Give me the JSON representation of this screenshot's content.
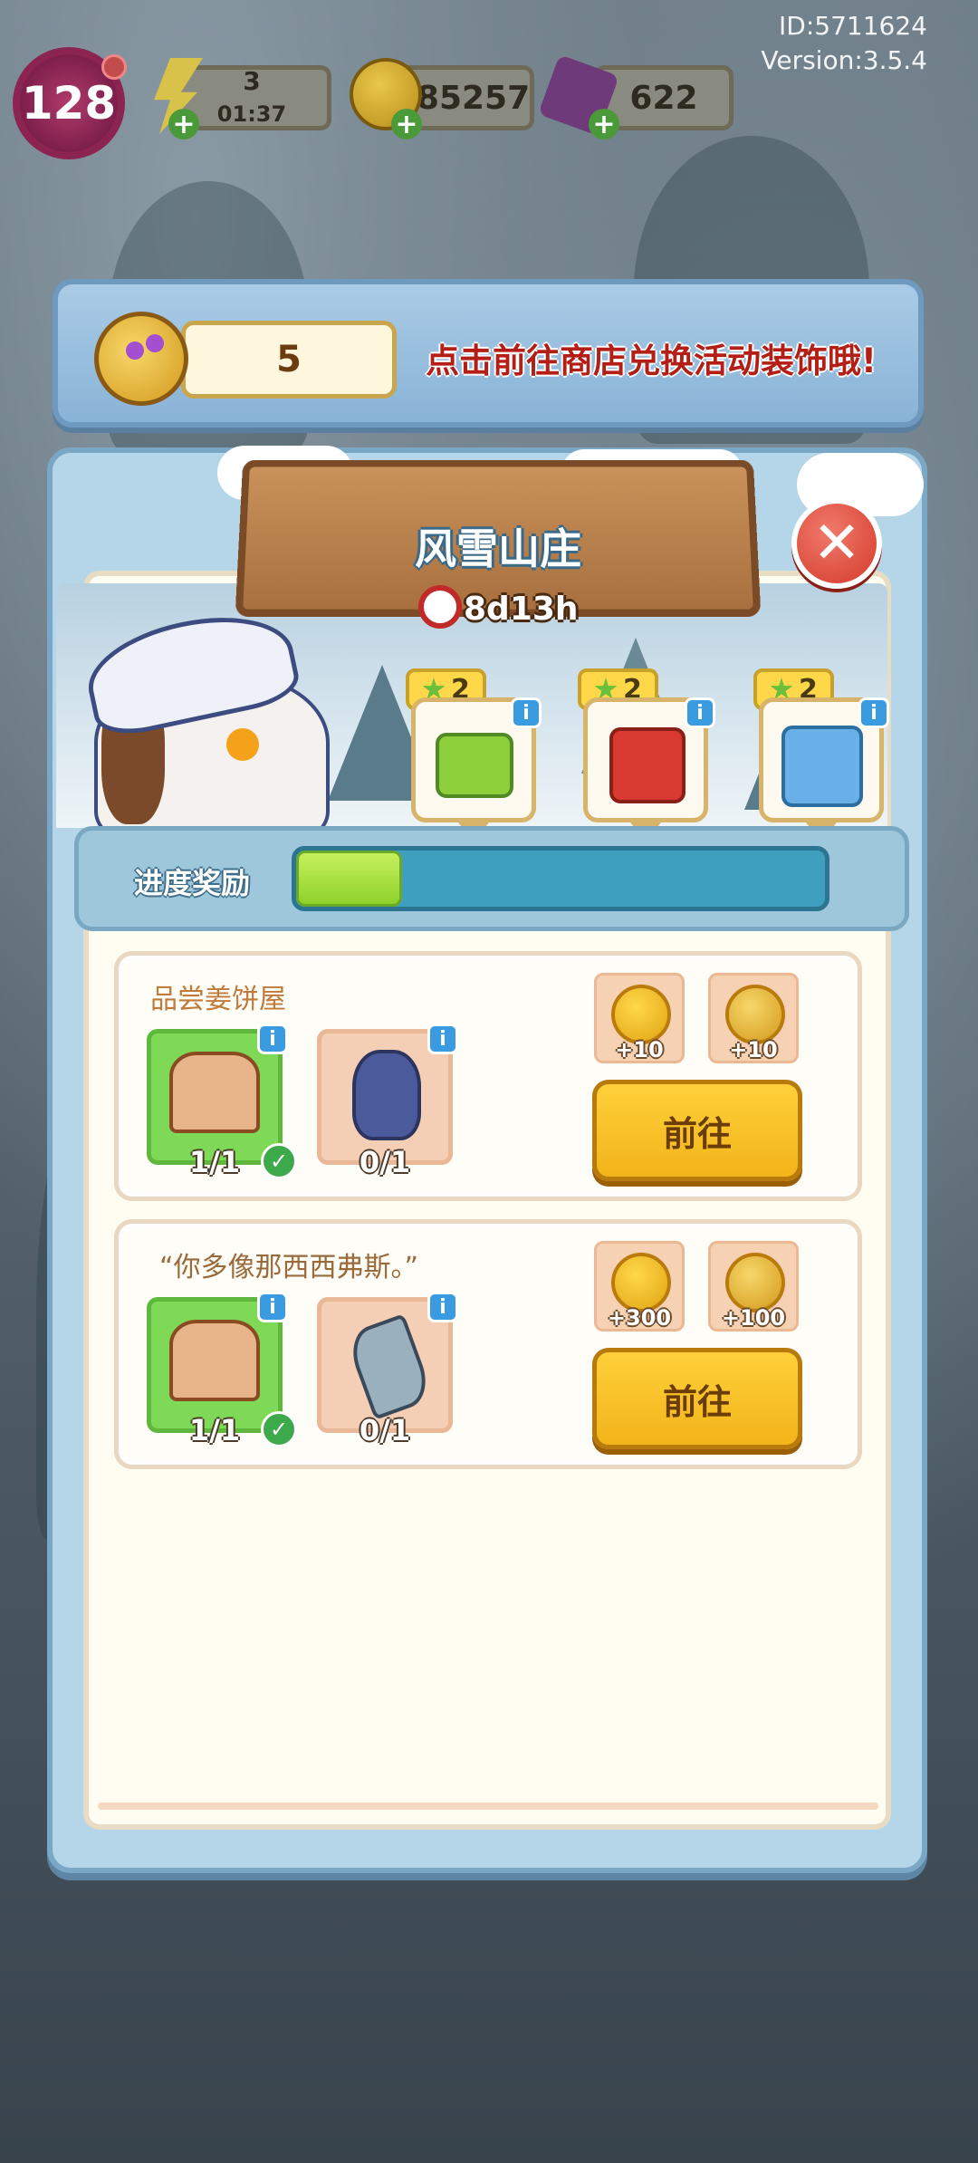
{
  "header": {
    "player_id": "ID:5711624",
    "version": "Version:3.5.4",
    "level": "128",
    "energy": {
      "value": "3",
      "timer": "01:37"
    },
    "coins": "285257",
    "gems": "622"
  },
  "banner": {
    "key_count": "5",
    "message": "点击前往商店兑换活动装饰哦!"
  },
  "event": {
    "title": "风雪山庄",
    "time_left": "8d13h"
  },
  "rewards": [
    {
      "stars": "2",
      "gift": "green-gift-icon"
    },
    {
      "stars": "2",
      "gift": "red-gift-icon"
    },
    {
      "stars": "2",
      "gift": "blue-gift-icon"
    }
  ],
  "progress": {
    "label": "进度奖励",
    "fraction": 0.2
  },
  "tasks": [
    {
      "title": "品尝姜饼屋",
      "items": [
        {
          "icon": "gingerbread-house-icon",
          "count": "1/1",
          "done": true
        },
        {
          "icon": "castle-snowglobe-icon",
          "count": "0/1",
          "done": false
        }
      ],
      "rewards": [
        {
          "icon": "coin-icon",
          "amount": "+10"
        },
        {
          "icon": "key-icon",
          "amount": "+10"
        }
      ],
      "button": "前往"
    },
    {
      "title": "“你多像那西西弗斯。”",
      "items": [
        {
          "icon": "gingerbread-house-icon",
          "count": "1/1",
          "done": true
        },
        {
          "icon": "axe-icon",
          "count": "0/1",
          "done": false
        }
      ],
      "rewards": [
        {
          "icon": "coin-icon",
          "amount": "+300"
        },
        {
          "icon": "key-icon",
          "amount": "+100"
        }
      ],
      "button": "前往"
    }
  ],
  "colors": {
    "accent": "#f2b41a",
    "progress_fill": "#a6e23a",
    "close": "#d43a2c",
    "banner_text": "#b31f16"
  }
}
